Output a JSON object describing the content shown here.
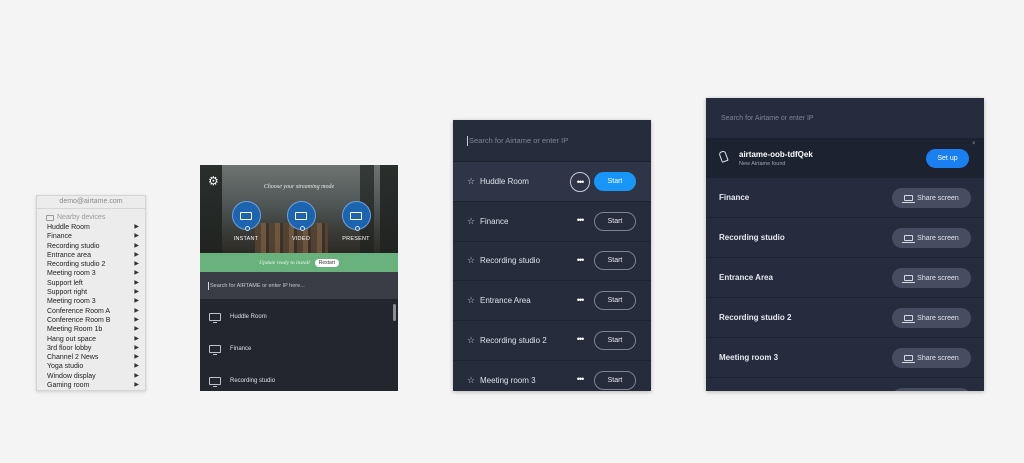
{
  "menu": {
    "email": "demo@airtame.com",
    "nearby_label": "Nearby devices",
    "items": [
      "Huddle Room",
      "Finance",
      "Recording studio",
      "Entrance area",
      "Recording studio 2",
      "Meeting room 3",
      "Support left",
      "Support right",
      "Meeting room 3",
      "Conference Room A",
      "Conference Room B",
      "Meeting Room 1b",
      "Hang out space",
      "3rd floor lobby",
      "Channel 2 News",
      "Yoga studio",
      "Window display",
      "Gaming room"
    ]
  },
  "app2": {
    "mode_title": "Choose your streaming mode",
    "modes": [
      {
        "label": "INSTANT"
      },
      {
        "label": "VIDEO"
      },
      {
        "label": "PRESENT"
      }
    ],
    "update_text": "Update ready to install",
    "restart_label": "Restart",
    "search_placeholder": "Search for AIRTAME or enter IP here...",
    "devices": [
      "Huddle Room",
      "Finance",
      "Recording studio"
    ],
    "colors": {
      "accent": "#1c63b0",
      "update_bar": "#6ab27d"
    }
  },
  "app3": {
    "search_placeholder": "Search for Airtame or enter IP",
    "start_label": "Start",
    "rows": [
      "Huddle Room",
      "Finance",
      "Recording studio",
      "Entrance Area",
      "Recording studio 2",
      "Meeting room 3"
    ],
    "colors": {
      "primary": "#1796f7"
    }
  },
  "app4": {
    "search_placeholder": "Search for Airtame or enter IP",
    "notice": {
      "name": "airtame-oob-tdfQek",
      "sub": "New Airtame found",
      "setup_label": "Set up",
      "close": "×"
    },
    "share_label": "Share screen",
    "rows": [
      "Finance",
      "Recording studio",
      "Entrance Area",
      "Recording studio 2",
      "Meeting room 3",
      ""
    ],
    "colors": {
      "primary": "#1a7ff0"
    }
  }
}
